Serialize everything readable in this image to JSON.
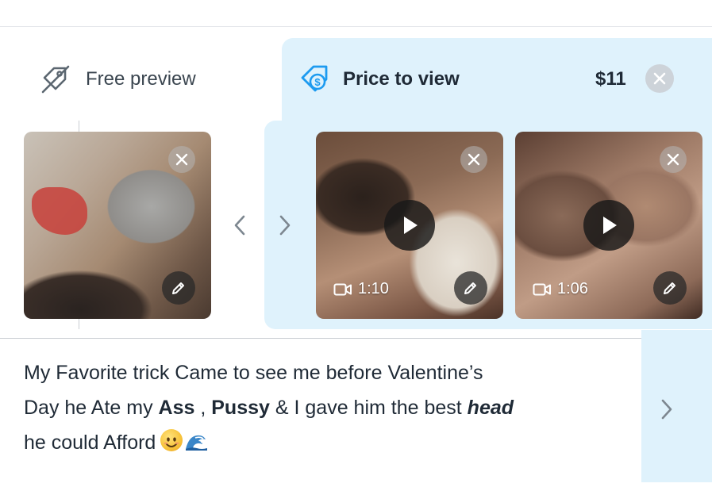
{
  "tabs": {
    "free_preview": {
      "label": "Free preview",
      "icon": "price-tag-slash-icon"
    },
    "price_to_view": {
      "label": "Price to view",
      "icon": "dollar-tag-icon",
      "price": "$11",
      "clear_icon": "close-circle-icon"
    }
  },
  "media": {
    "free_item": {
      "type": "image",
      "actions": [
        "remove",
        "edit"
      ]
    },
    "paid_items": [
      {
        "type": "video",
        "duration": "1:10",
        "actions": [
          "remove",
          "play",
          "edit"
        ]
      },
      {
        "type": "video",
        "duration": "1:06",
        "actions": [
          "remove",
          "play",
          "edit"
        ]
      }
    ]
  },
  "caption": {
    "line1": "My Favorite trick Came to see me before Valentine’s",
    "line2_a": "Day he Ate my ",
    "line2_b": "Ass",
    "line2_c": " , ",
    "line2_d": "Pussy",
    "line2_e": " & I gave him the best ",
    "line2_f": "head",
    "line3": "he could Afford",
    "emojis": [
      "smiling-face-icon",
      "water-wave-icon"
    ]
  },
  "colors": {
    "active_bg": "#dff2fc",
    "accent_blue": "#1d9bf0",
    "text": "#1f2a36",
    "muted": "#3b4650"
  }
}
